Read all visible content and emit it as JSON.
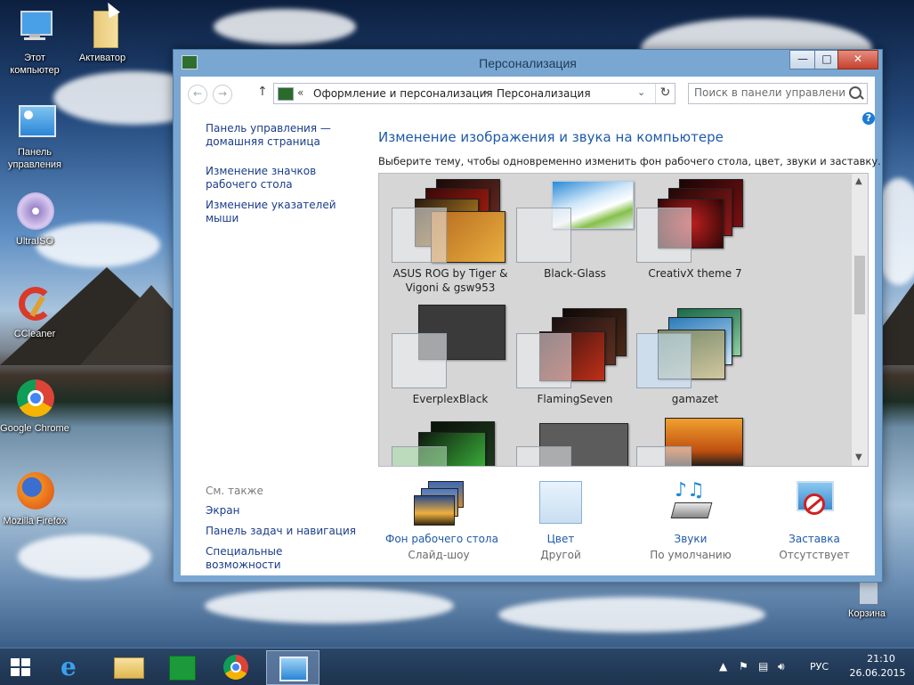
{
  "desktop": {
    "icons": [
      {
        "label": "Этот компьютер"
      },
      {
        "label": "Активатор"
      },
      {
        "label": "Панель управления"
      },
      {
        "label": "UltraISO"
      },
      {
        "label": "CCleaner"
      },
      {
        "label": "Google Chrome"
      },
      {
        "label": "Mozilla Firefox"
      },
      {
        "label": "Корзина"
      }
    ]
  },
  "window": {
    "title": "Персонализация",
    "controls": {
      "minimize": "—",
      "maximize": "□",
      "close": "✕"
    }
  },
  "address_bar": {
    "overflow": "«",
    "crumbs": [
      "Оформление и персонализация",
      "Персонализация"
    ],
    "separator": "›",
    "search_placeholder": "Поиск в панели управления"
  },
  "left_pane": {
    "links": [
      "Панель управления — домашняя страница",
      "Изменение значков рабочего стола",
      "Изменение указателей мыши"
    ],
    "see_also_title": "См. также",
    "see_also": [
      "Экран",
      "Панель задач и навигация",
      "Специальные возможности"
    ]
  },
  "main": {
    "title": "Изменение изображения и звука на компьютере",
    "subtitle": "Выберите тему, чтобы одновременно изменить фон рабочего стола, цвет, звуки и заставку.",
    "themes": [
      {
        "label": "ASUS ROG by Tiger & Vigoni & gsw953",
        "color": "#5a1a12"
      },
      {
        "label": "Black-Glass",
        "color": "#d7e9f7"
      },
      {
        "label": "CreativX theme 7",
        "color": "#4a0a0a"
      },
      {
        "label": "EverplexBlack",
        "color": "#3a3a3a"
      },
      {
        "label": "FlamingSeven",
        "color": "#2a1612"
      },
      {
        "label": "gamazet",
        "color": "#8fb3a0"
      },
      {
        "label": "",
        "color": "#0d1a0d"
      },
      {
        "label": "",
        "color": "#5c5c5c"
      },
      {
        "label": "",
        "color": "#d2791e"
      }
    ]
  },
  "settings": [
    {
      "name": "Фон рабочего стола",
      "value": "Слайд-шоу"
    },
    {
      "name": "Цвет",
      "value": "Другой"
    },
    {
      "name": "Звуки",
      "value": "По умолчанию"
    },
    {
      "name": "Заставка",
      "value": "Отсутствует"
    }
  ],
  "taskbar": {
    "language": "РУС",
    "time": "21:10",
    "date": "26.06.2015"
  },
  "colors": {
    "link": "#1a3d8a",
    "heading": "#1e5aa8",
    "window_frame": "#7aa7d1",
    "taskbar": "#1d334e"
  }
}
